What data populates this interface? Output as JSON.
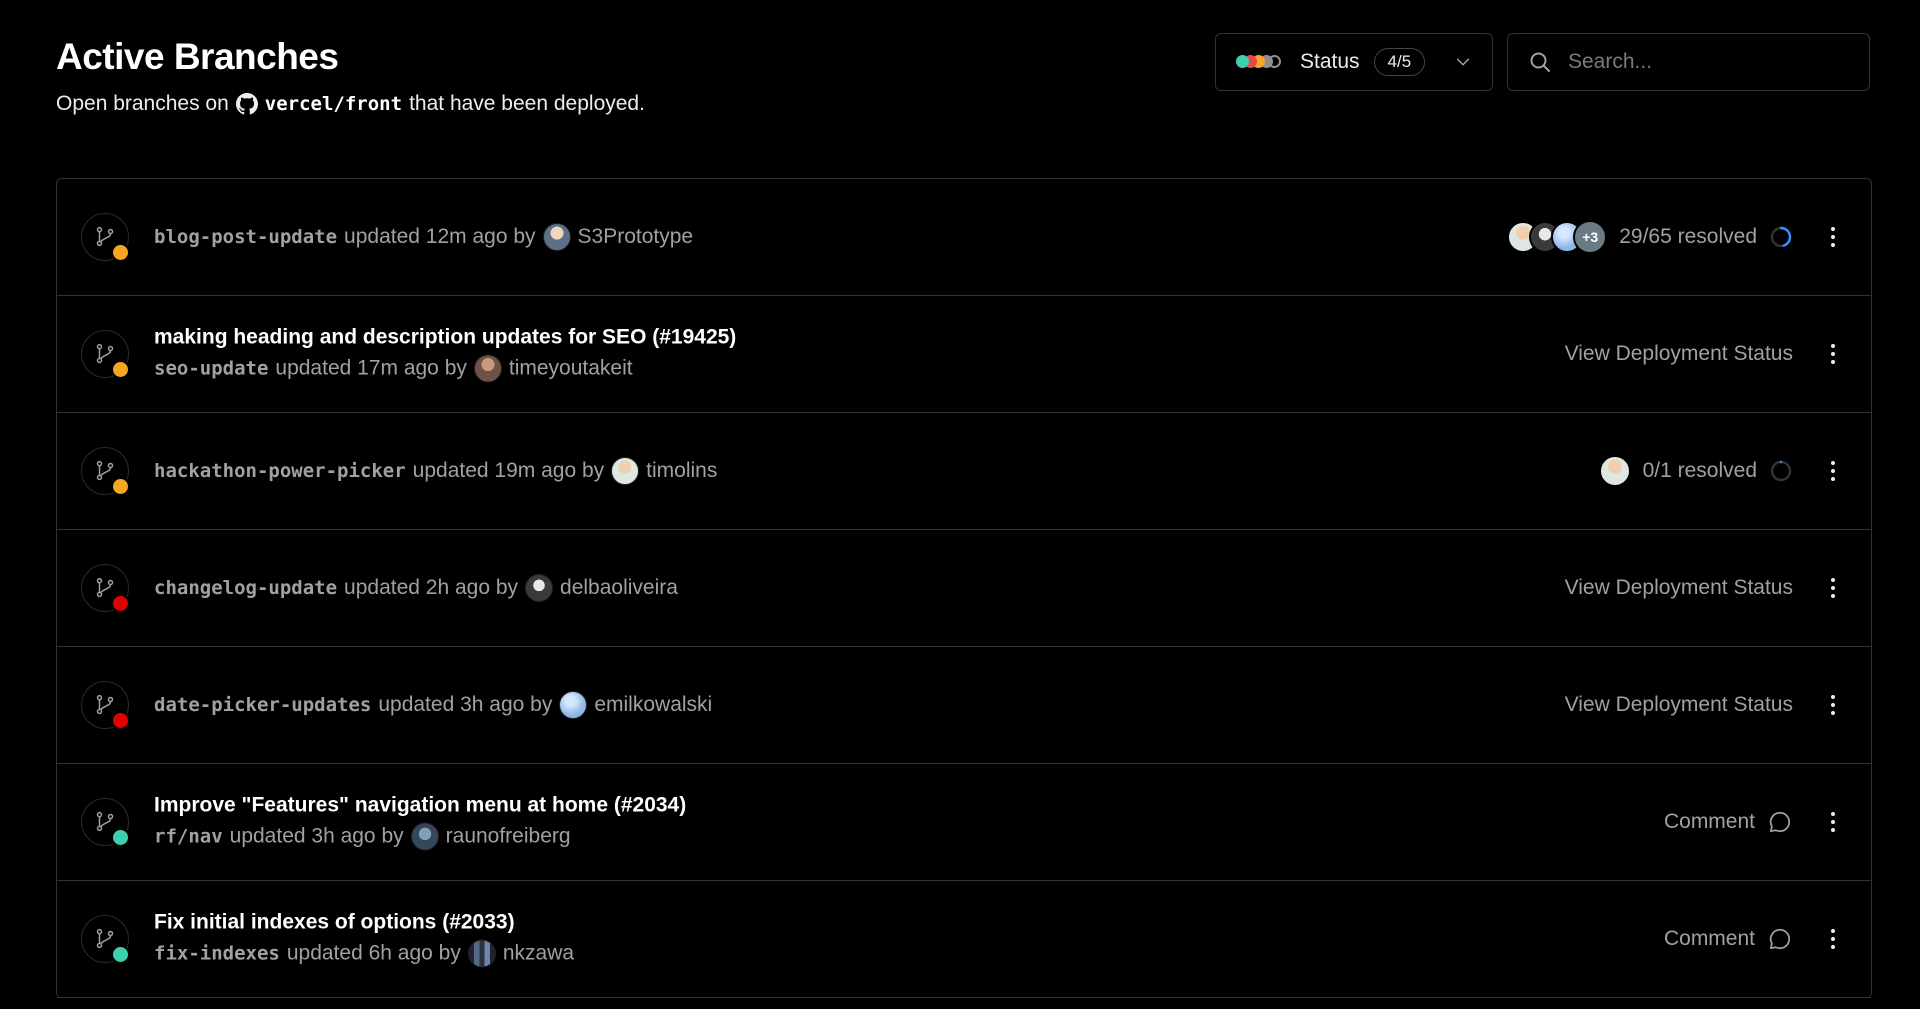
{
  "header": {
    "title": "Active Branches",
    "subtitle_prefix": "Open branches on",
    "repo": "vercel/front",
    "subtitle_suffix": "that have been deployed.",
    "repo_icon": "github-icon"
  },
  "status_filter": {
    "label": "Status",
    "count": "4/5",
    "dot_colors": [
      "#3bd1b0",
      "#e5484d",
      "#f5a623",
      "#8f8f8f",
      "#000000"
    ]
  },
  "search": {
    "placeholder": "Search..."
  },
  "colors": {
    "ready": "#3bd1b0",
    "building": "#f5a623",
    "error": "#e00000",
    "progress": "#3291ff"
  },
  "rows": [
    {
      "pr_title": "",
      "branch": "blog-post-update",
      "updated": "updated 12m ago by",
      "author": "S3Prototype",
      "status": "building",
      "right_type": "resolved",
      "resolved_text": "29/65 resolved",
      "resolved_fraction": 0.45,
      "extra_avatars": "+3"
    },
    {
      "pr_title": "making heading and description updates for SEO (#19425)",
      "branch": "seo-update",
      "updated": "updated 17m ago by",
      "author": "timeyoutakeit",
      "status": "building",
      "right_type": "deployment",
      "right_text": "View Deployment Status"
    },
    {
      "pr_title": "",
      "branch": "hackathon-power-picker",
      "updated": "updated 19m ago by",
      "author": "timolins",
      "status": "building",
      "right_type": "resolved-single",
      "resolved_text": "0/1 resolved",
      "resolved_fraction": 0
    },
    {
      "pr_title": "",
      "branch": "changelog-update",
      "updated": "updated 2h ago by",
      "author": "delbaoliveira",
      "status": "error",
      "right_type": "deployment",
      "right_text": "View Deployment Status"
    },
    {
      "pr_title": "",
      "branch": "date-picker-updates",
      "updated": "updated 3h ago by",
      "author": "emilkowalski",
      "status": "error",
      "right_type": "deployment",
      "right_text": "View Deployment Status"
    },
    {
      "pr_title": "Improve \"Features\" navigation menu at home (#2034)",
      "branch": "rf/nav",
      "updated": "updated 3h ago by",
      "author": "raunofreiberg",
      "status": "ready",
      "right_type": "comment",
      "right_text": "Comment"
    },
    {
      "pr_title": "Fix initial indexes of options (#2033)",
      "branch": "fix-indexes",
      "updated": "updated 6h ago by",
      "author": "nkzawa",
      "status": "ready",
      "right_type": "comment",
      "right_text": "Comment"
    }
  ]
}
